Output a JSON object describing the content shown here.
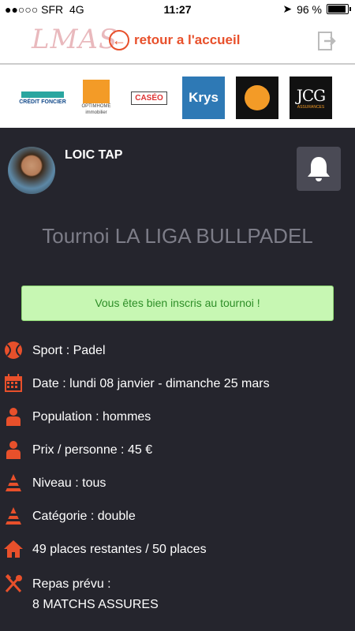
{
  "statusbar": {
    "carrier": "●●○○○ SFR",
    "network": "4G",
    "time": "11:27",
    "battery": "96 %"
  },
  "header": {
    "back_label": "retour a l'accueil"
  },
  "sponsors": {
    "credit_foncier": "CRÉDIT FONCIER",
    "optimhome": "OPTIMHOME immobilier",
    "caseo": "CASÉO",
    "krys": "Krys",
    "cara": "communication",
    "jcg": "JCG",
    "jcg_sub": "ASSURANCES"
  },
  "user": {
    "name": "LOIC TAP"
  },
  "tournament": {
    "title": "Tournoi LA LIGA BULLPADEL",
    "success": "Vous êtes bien inscris au tournoi !",
    "rows": [
      {
        "icon": "tennis-ball-icon",
        "text": "Sport : Padel"
      },
      {
        "icon": "calendar-icon",
        "text": "Date : lundi 08 janvier - dimanche 25 mars"
      },
      {
        "icon": "person-icon",
        "text": "Population : hommes"
      },
      {
        "icon": "person-icon",
        "text": "Prix / personne : 45 €"
      },
      {
        "icon": "cone-icon",
        "text": "Niveau : tous"
      },
      {
        "icon": "cone-icon",
        "text": "Catégorie : double"
      },
      {
        "icon": "home-icon",
        "text": "49 places restantes / 50 places"
      },
      {
        "icon": "utensils-icon",
        "text": "Repas prévu :"
      },
      {
        "icon": "",
        "text": "8 MATCHS ASSURES"
      }
    ]
  },
  "colors": {
    "accent": "#e8502b",
    "background": "#25252d",
    "success_bg": "#c7f7b3",
    "success_text": "#2e8e28"
  }
}
